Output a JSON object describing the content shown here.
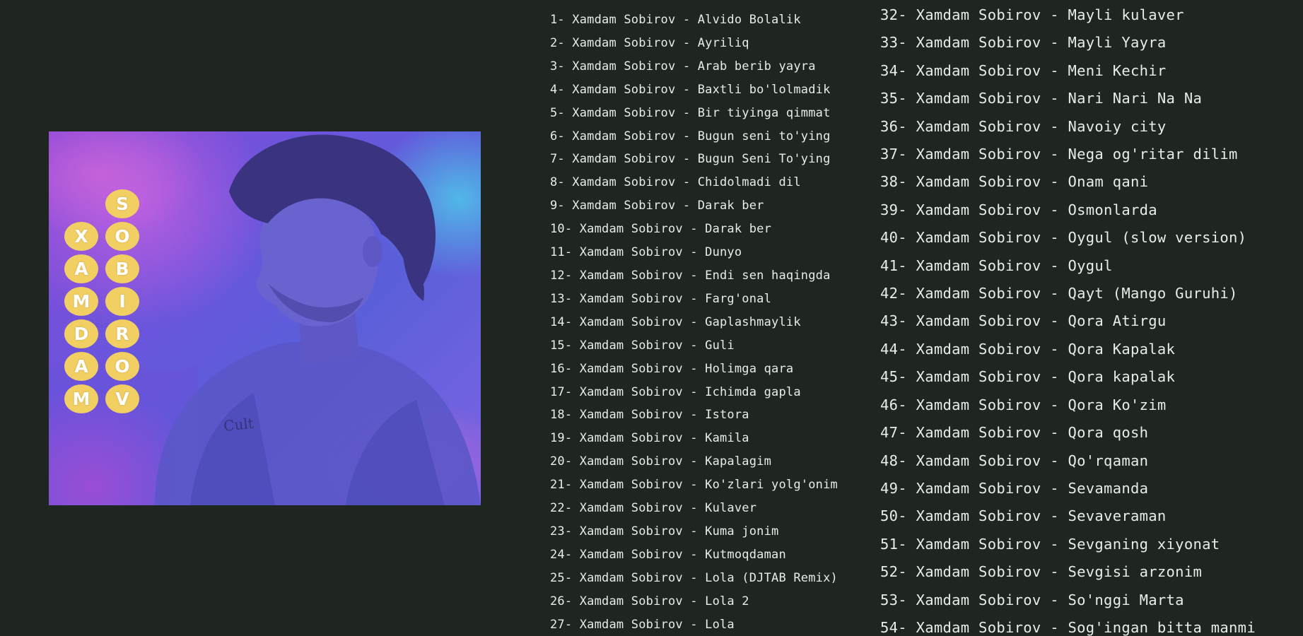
{
  "album_art": {
    "shirt_text": "Cult",
    "first_name_letters": [
      "X",
      "A",
      "M",
      "D",
      "A",
      "M"
    ],
    "last_name_letters": [
      "S",
      "O",
      "B",
      "I",
      "R",
      "O",
      "V"
    ],
    "colors": {
      "bubble": "#f2cf63",
      "bubble_text": "#ffffff",
      "background": "#1f2620",
      "art_purple": "#7a52dc",
      "art_blue": "#52b8e8"
    }
  },
  "tracks_column_1": [
    "1- Xamdam Sobirov - Alvido Bolalik",
    "2- Xamdam Sobirov - Ayriliq",
    "3- Xamdam Sobirov - Arab berib yayra",
    "4- Xamdam Sobirov - Baxtli bo'lolmadik",
    "5- Xamdam Sobirov - Bir tiyinga qimmat",
    "6- Xamdam Sobirov - Bugun seni to'ying",
    "7- Xamdam Sobirov - Bugun Seni To'ying",
    "8- Xamdam Sobirov - Chidolmadi dil",
    "9- Xamdam Sobirov - Darak ber",
    "10- Xamdam Sobirov - Darak ber",
    "11- Xamdam Sobirov - Dunyo",
    "12- Xamdam Sobirov - Endi sen haqingda",
    "13- Xamdam Sobirov - Farg'onal",
    "14- Xamdam Sobirov - Gaplashmaylik",
    "15- Xamdam Sobirov - Guli",
    "16- Xamdam Sobirov - Holimga qara",
    "17- Xamdam Sobirov - Ichimda gapla",
    "18- Xamdam Sobirov - Istora",
    "19- Xamdam Sobirov - Kamila",
    "20- Xamdam Sobirov - Kapalagim",
    "21- Xamdam Sobirov - Ko'zlari yolg'onim",
    "22- Xamdam Sobirov - Kulaver",
    "23- Xamdam Sobirov - Kuma jonim",
    "24- Xamdam Sobirov - Kutmoqdaman",
    "25- Xamdam Sobirov - Lola (DJTAB Remix)",
    "26- Xamdam Sobirov - Lola 2",
    "27- Xamdam Sobirov - Lola"
  ],
  "tracks_column_2": [
    "32- Xamdam Sobirov - Mayli kulaver",
    "33- Xamdam Sobirov - Mayli Yayra",
    "34- Xamdam Sobirov - Meni Kechir",
    "35- Xamdam Sobirov - Nari Nari Na Na",
    "36- Xamdam Sobirov - Navoiy city",
    "37- Xamdam Sobirov - Nega og'ritar dilim",
    "38- Xamdam Sobirov - Onam qani",
    "39- Xamdam Sobirov - Osmonlarda",
    "40- Xamdam Sobirov - Oygul (slow version)",
    "41- Xamdam Sobirov - Oygul",
    "42- Xamdam Sobirov - Qayt (Mango Guruhi)",
    "43- Xamdam Sobirov - Qora Atirgu",
    "44- Xamdam Sobirov - Qora Kapalak",
    "45- Xamdam Sobirov - Qora kapalak",
    "46- Xamdam Sobirov - Qora Ko'zim",
    "47- Xamdam Sobirov - Qora qosh",
    "48- Xamdam Sobirov - Qo'rqaman",
    "49- Xamdam Sobirov - Sevamanda",
    "50- Xamdam Sobirov - Sevaveraman",
    "51- Xamdam Sobirov - Sevganing xiyonat",
    "52- Xamdam Sobirov - Sevgisi arzonim",
    "53- Xamdam Sobirov - So'nggi Marta",
    "54- Xamdam Sobirov - Sog'ingan bitta manmi"
  ]
}
